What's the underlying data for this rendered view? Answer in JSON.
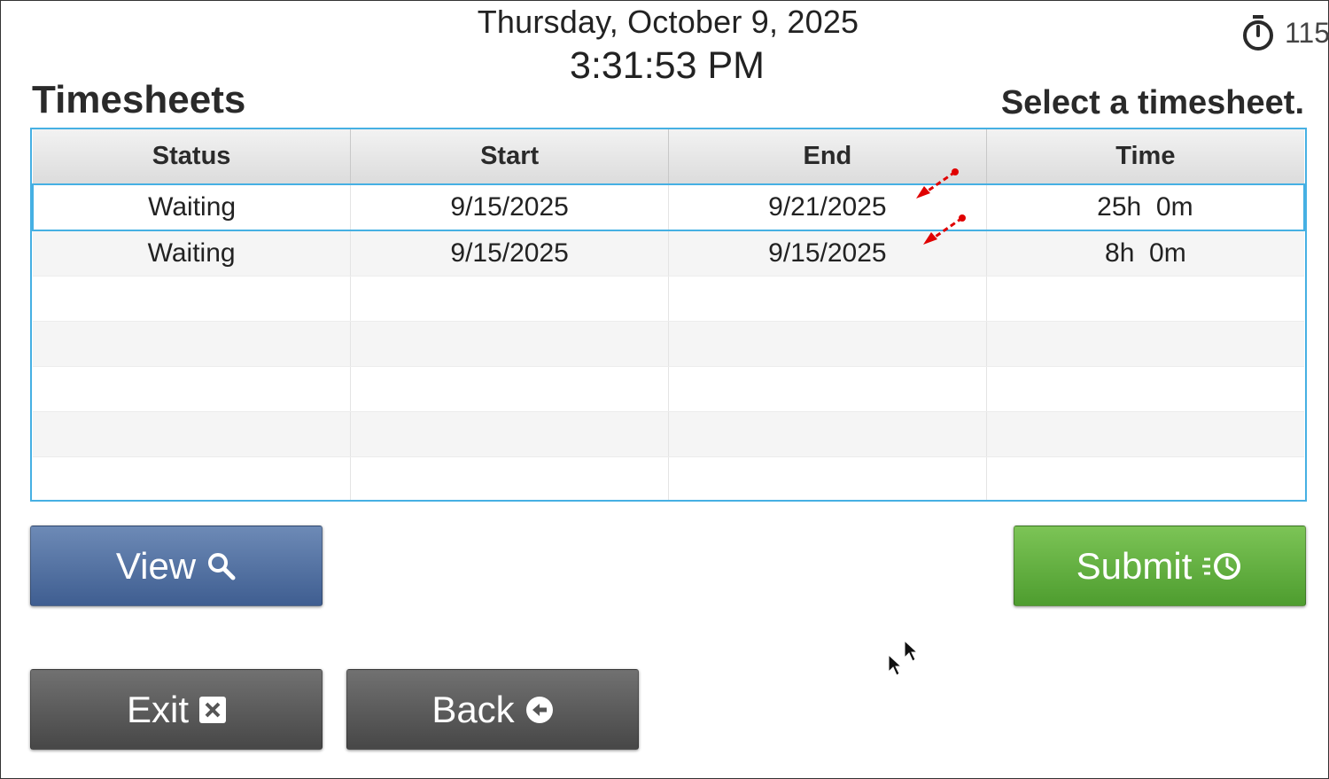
{
  "header": {
    "date": "Thursday, October 9, 2025",
    "time": "3:31:53 PM",
    "timer_value": "115"
  },
  "page": {
    "title": "Timesheets",
    "instruction": "Select a timesheet."
  },
  "table": {
    "columns": [
      "Status",
      "Start",
      "End",
      "Time"
    ],
    "rows": [
      {
        "status": "Waiting",
        "start": "9/15/2025",
        "end": "9/21/2025",
        "time": "25h  0m"
      },
      {
        "status": "Waiting",
        "start": "9/15/2025",
        "end": "9/15/2025",
        "time": "8h  0m"
      }
    ],
    "selected_row": 0
  },
  "buttons": {
    "view": "View",
    "submit": "Submit",
    "exit": "Exit",
    "back": "Back"
  },
  "icons": {
    "timer": "stopwatch-icon",
    "view": "magnifier-icon",
    "submit": "clock-submit-icon",
    "exit": "close-box-icon",
    "back": "back-arrow-circle-icon"
  },
  "colors": {
    "accent": "#46b0e3",
    "view_button": "#4f6fa3",
    "submit_button": "#5fae3c",
    "neutral_button": "#5a5a5a",
    "annotation_arrow": "#e00000"
  }
}
